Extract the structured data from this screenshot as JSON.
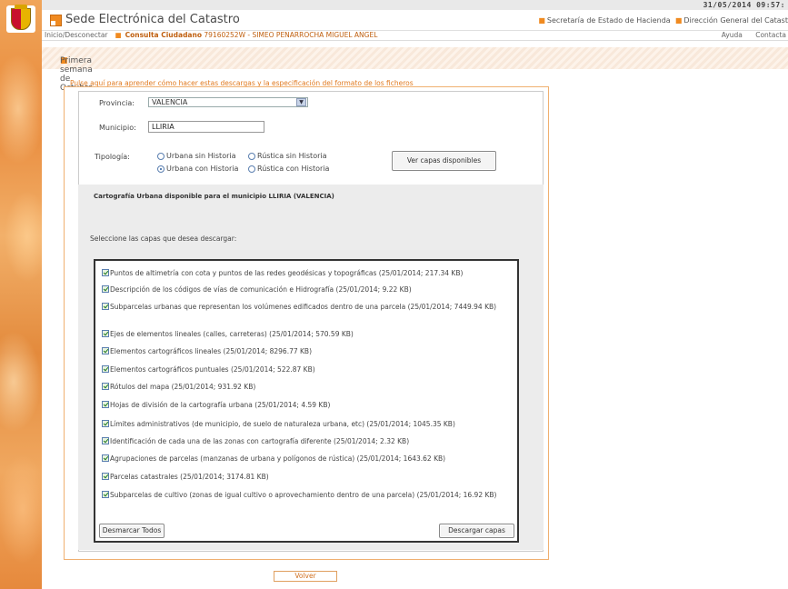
{
  "header": {
    "datetime": "31/05/2014 09:57:",
    "site_title": "Sede Electrónica del Catastro",
    "links": [
      "Secretaría de Estado de Hacienda",
      "Dirección General del Catast"
    ]
  },
  "nav": {
    "home": "Inicio/Desconectar",
    "consulta": "Consulta Ciudadano",
    "user": "79160252W - SIMEO PENARROCHA MIGUEL ANGEL",
    "help": "Ayuda",
    "contact": "Contacta"
  },
  "notice": {
    "text": "Primera semana de Octubre."
  },
  "help_link": "Pulse aquí para aprender cómo hacer estas descargas y la especificación del formato de los ficheros",
  "form": {
    "provincia_label": "Provincia:",
    "provincia_value": "VALENCIA",
    "municipio_label": "Municipio:",
    "municipio_value": "LLIRIA",
    "tipologia_label": "Tipología:",
    "options": {
      "urbana_sin": "Urbana sin Historia",
      "rustica_sin": "Rústica sin Historia",
      "urbana_con": "Urbana con Historia",
      "rustica_con": "Rústica con Historia"
    },
    "selected_option": "Urbana con Historia",
    "ver_capas_button": "Ver capas disponibles"
  },
  "cartografia": {
    "title": "Cartografía Urbana disponible para el municipio LLIRIA (VALENCIA)",
    "select_label": "Seleccione las capas que desea descargar:",
    "layers": [
      {
        "label": "Puntos de altimetría con cota y puntos de las redes geodésicas y topográficas (25/01/2014; 217.34 KB)",
        "checked": true
      },
      {
        "label": "Descripción de los códigos de vías de comunicación e Hidrografía (25/01/2014; 9.22 KB)",
        "checked": true
      },
      {
        "label": "Subparcelas urbanas que representan los volúmenes edificados dentro de una parcela (25/01/2014; 7449.94 KB)",
        "checked": true
      },
      {
        "label": "Ejes de elementos lineales (calles, carreteras) (25/01/2014; 570.59 KB)",
        "checked": true
      },
      {
        "label": "Elementos cartográficos lineales (25/01/2014; 8296.77 KB)",
        "checked": true
      },
      {
        "label": "Elementos cartográficos puntuales (25/01/2014; 522.87 KB)",
        "checked": true
      },
      {
        "label": "Rótulos del mapa (25/01/2014; 931.92 KB)",
        "checked": true
      },
      {
        "label": "Hojas de división de la cartografía urbana (25/01/2014; 4.59 KB)",
        "checked": true
      },
      {
        "label": "Límites administrativos (de municipio, de suelo de naturaleza urbana, etc) (25/01/2014; 1045.35 KB)",
        "checked": true
      },
      {
        "label": "Identificación de cada una de las zonas con cartografía diferente (25/01/2014; 2.32 KB)",
        "checked": true
      },
      {
        "label": "Agrupaciones de parcelas (manzanas de urbana y polígonos de rústica) (25/01/2014; 1643.62 KB)",
        "checked": true
      },
      {
        "label": "Parcelas catastrales (25/01/2014; 3174.81 KB)",
        "checked": true
      },
      {
        "label": "Subparcelas de cultivo (zonas de igual cultivo o aprovechamiento dentro de una parcela) (25/01/2014; 16.92 KB)",
        "checked": true
      }
    ],
    "desmarcar_button": "Desmarcar Todos",
    "descargar_button": "Descargar capas"
  },
  "volver_button": "Volver"
}
